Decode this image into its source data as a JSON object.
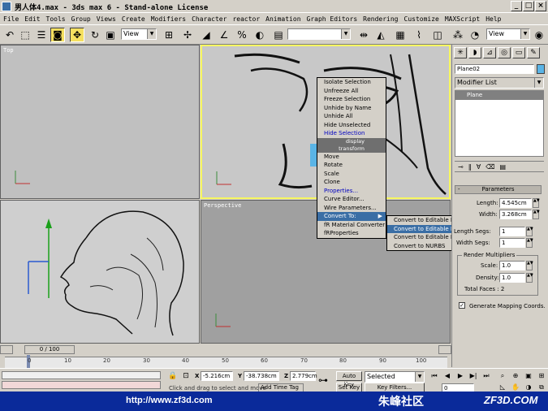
{
  "window": {
    "title": "男人体4.max - 3ds max 6 - Stand-alone License"
  },
  "menu": [
    "File",
    "Edit",
    "Tools",
    "Group",
    "Views",
    "Create",
    "Modifiers",
    "Character",
    "reactor",
    "Animation",
    "Graph Editors",
    "Rendering",
    "Customize",
    "MAXScript",
    "Help"
  ],
  "toolbar": {
    "refcoord": "View",
    "refcoord_right": "View",
    "named_sel": ""
  },
  "viewports": {
    "top": "Top",
    "front": "",
    "left": "",
    "perspective": "Perspective"
  },
  "quadmenu": {
    "display": [
      "Isolate Selection",
      "Unfreeze All",
      "Freeze Selection",
      "Unhide by Name",
      "Unhide All",
      "Hide Unselected",
      "Hide Selection"
    ],
    "display_label": "display",
    "transform_label": "transform",
    "transform": [
      "Move",
      "Rotate",
      "Scale",
      "Clone",
      "Properties...",
      "Curve Editor...",
      "Wire Parameters...",
      "Convert To:",
      "fR Material Converter",
      "fRProperties"
    ],
    "submenu": [
      "Convert to Editable Mesh",
      "Convert to Editable Poly",
      "Convert to Editable Patch",
      "Convert to NURBS"
    ]
  },
  "cmdpanel": {
    "object_name": "Plane02",
    "modifier_list": "Modifier List",
    "stack_item": "Plane",
    "rollout_title": "Parameters",
    "length_label": "Length:",
    "length_value": "4.545cm",
    "width_label": "Width:",
    "width_value": "3.268cm",
    "lsegs_label": "Length Segs:",
    "lsegs_value": "1",
    "wsegs_label": "Width Segs:",
    "wsegs_value": "1",
    "render_mult": "Render Multipliers",
    "scale_label": "Scale:",
    "scale_value": "1.0",
    "density_label": "Density:",
    "density_value": "1.0",
    "total_faces": "Total Faces : 2",
    "gen_map": "Generate Mapping Coords."
  },
  "timeline": {
    "frame": "0 / 100",
    "ticks": [
      "0",
      "10",
      "20",
      "30",
      "40",
      "50",
      "60",
      "70",
      "80",
      "90",
      "100"
    ]
  },
  "status": {
    "x_label": "X",
    "x_value": "-5.216cm",
    "y_label": "Y",
    "y_value": "-38.738cm",
    "z_label": "Z",
    "z_value": "2.779cm",
    "prompt": "Click and drag to select and move",
    "add_time_tag": "Add Time Tag",
    "auto_key": "Auto Key",
    "set_key": "Set Key",
    "selected": "Selected",
    "key_filters": "Key Filters...",
    "frame_num": "0"
  },
  "banner": {
    "url": "http://www.zf3d.com",
    "cn": "朱峰社区",
    "brand": "ZF3D.COM"
  },
  "colors": {
    "active_border": "#f6f660",
    "highlight": "#3a6ea5",
    "banner": "#0a2a9a"
  }
}
